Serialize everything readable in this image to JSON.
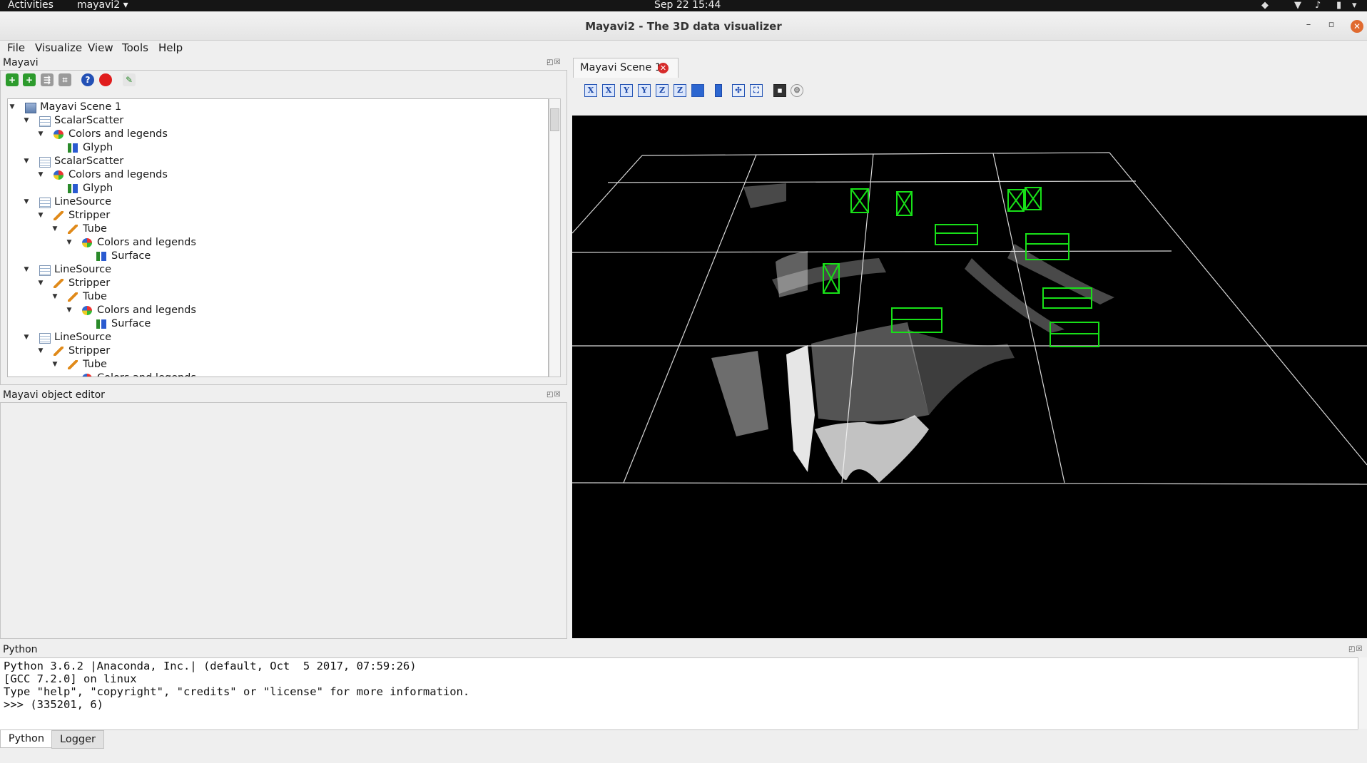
{
  "topbar": {
    "activities": "Activities",
    "app_menu": "mayavi2",
    "clock": "Sep 22  15:44"
  },
  "window": {
    "title": "Mayavi2 - The 3D data visualizer",
    "minimize": "–",
    "maximize": "▫",
    "close": "✕"
  },
  "menubar": {
    "items": [
      "File",
      "Visualize",
      "View",
      "Tools",
      "Help"
    ]
  },
  "pipeline_panel": {
    "title": "Mayavi",
    "dock_buttons": "◰☒",
    "tree": [
      {
        "label": "Mayavi Scene 1",
        "icon": "scene-icon"
      },
      {
        "label": "ScalarScatter",
        "icon": "data-source-icon"
      },
      {
        "label": "Colors and legends",
        "icon": "colors-legends-icon"
      },
      {
        "label": "Glyph",
        "icon": "module-icon"
      },
      {
        "label": "ScalarScatter",
        "icon": "data-source-icon"
      },
      {
        "label": "Colors and legends",
        "icon": "colors-legends-icon"
      },
      {
        "label": "Glyph",
        "icon": "module-icon"
      },
      {
        "label": "LineSource",
        "icon": "data-source-icon"
      },
      {
        "label": "Stripper",
        "icon": "filter-icon"
      },
      {
        "label": "Tube",
        "icon": "filter-icon"
      },
      {
        "label": "Colors and legends",
        "icon": "colors-legends-icon"
      },
      {
        "label": "Surface",
        "icon": "module-icon"
      },
      {
        "label": "LineSource",
        "icon": "data-source-icon"
      },
      {
        "label": "Stripper",
        "icon": "filter-icon"
      },
      {
        "label": "Tube",
        "icon": "filter-icon"
      },
      {
        "label": "Colors and legends",
        "icon": "colors-legends-icon"
      },
      {
        "label": "Surface",
        "icon": "module-icon"
      },
      {
        "label": "LineSource",
        "icon": "data-source-icon"
      },
      {
        "label": "Stripper",
        "icon": "filter-icon"
      },
      {
        "label": "Tube",
        "icon": "filter-icon"
      },
      {
        "label": "Colors and legends",
        "icon": "colors-legends-icon"
      }
    ]
  },
  "editor_panel": {
    "title": "Mayavi object editor",
    "dock_buttons": "◰☒"
  },
  "scene": {
    "tab_label": "Mayavi Scene 1",
    "toolbar_axes": [
      "X",
      "X",
      "Y",
      "Y",
      "Z",
      "Z"
    ]
  },
  "python_panel": {
    "title": "Python",
    "dock_buttons": "◰☒",
    "lines": [
      "Python 3.6.2 |Anaconda, Inc.| (default, Oct  5 2017, 07:59:26)",
      "[GCC 7.2.0] on linux",
      "Type \"help\", \"copyright\", \"credits\" or \"license\" for more information.",
      ">>> (335201, 6)"
    ],
    "tabs": [
      "Python",
      "Logger"
    ]
  }
}
